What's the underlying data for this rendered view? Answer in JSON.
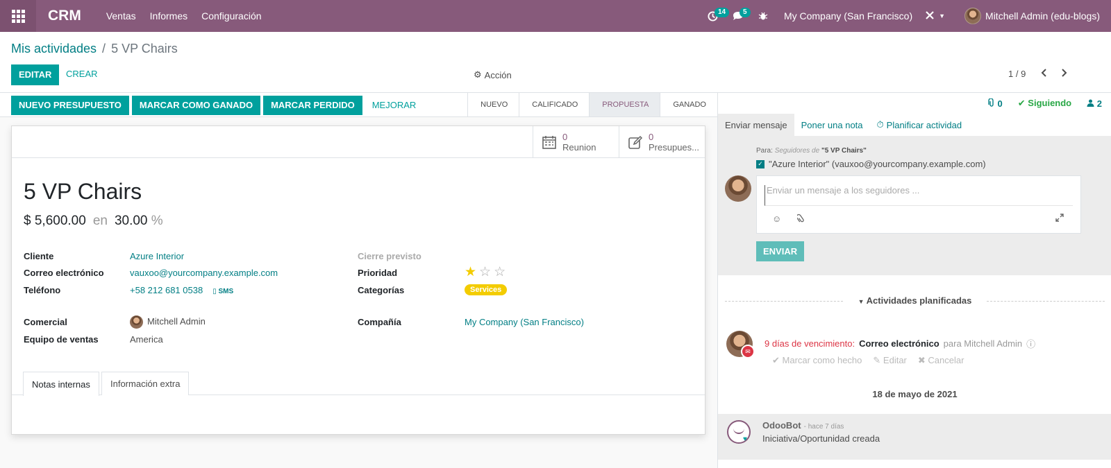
{
  "navbar": {
    "brand": "CRM",
    "menu": [
      "Ventas",
      "Informes",
      "Configuración"
    ],
    "activity_count": "14",
    "message_count": "5",
    "company": "My Company (San Francisco)",
    "user": "Mitchell Admin (edu-blogs)"
  },
  "breadcrumb": {
    "parent": "Mis actividades",
    "separator": "/",
    "current": "5 VP Chairs"
  },
  "toolbar": {
    "edit": "EDITAR",
    "create": "CREAR",
    "action": "Acción",
    "pager": "1 / 9"
  },
  "statusbar": {
    "buttons": [
      "NUEVO PRESUPUESTO",
      "MARCAR COMO GANADO",
      "MARCAR PERDIDO"
    ],
    "upgrade": "MEJORAR",
    "stages": [
      "NUEVO",
      "CALIFICADO",
      "PROPUESTA",
      "GANADO"
    ],
    "active_stage": "PROPUESTA"
  },
  "stats": {
    "meetings_count": "0",
    "meetings_label": "Reunion",
    "quotes_count": "0",
    "quotes_label": "Presupues..."
  },
  "record": {
    "title": "5 VP Chairs",
    "revenue": "$ 5,600.00",
    "at": "en",
    "probability": "30.00",
    "percent": "%"
  },
  "fields": {
    "customer_label": "Cliente",
    "customer": "Azure Interior",
    "email_label": "Correo electrónico",
    "email": "vauxoo@yourcompany.example.com",
    "phone_label": "Teléfono",
    "phone": "+58 212 681 0538",
    "sms": "SMS",
    "salesperson_label": "Comercial",
    "salesperson": "Mitchell Admin",
    "team_label": "Equipo de ventas",
    "team": "America",
    "deadline_label": "Cierre previsto",
    "priority_label": "Prioridad",
    "priority": 1,
    "priority_max": 3,
    "tags_label": "Categorías",
    "tag": "Services",
    "company_label": "Compañía",
    "company": "My Company (San Francisco)"
  },
  "tabs": [
    "Notas internas",
    "Información extra"
  ],
  "chatter": {
    "attachments": "0",
    "following": "Siguiendo",
    "followers": "2",
    "tabs": [
      "Enviar mensaje",
      "Poner una nota",
      "Planificar actividad"
    ],
    "to_label": "Para:",
    "to_followers": "Seguidores de",
    "to_record": "\"5 VP Chairs\"",
    "recipient": "\"Azure Interior\" (vauxoo@yourcompany.example.com)",
    "placeholder": "Enviar un mensaje a los seguidores ...",
    "send": "ENVIAR",
    "activities_header": "Actividades planificadas",
    "activity_due": "9 días de vencimiento:",
    "activity_type": "Correo electrónico",
    "activity_for": "para Mitchell Admin",
    "mark_done": "Marcar como hecho",
    "edit": "Editar",
    "cancel": "Cancelar",
    "date_separator": "18 de mayo de 2021",
    "message_author": "OdooBot",
    "message_date": "- hace 7 días",
    "message_body": "Iniciativa/Oportunidad creada"
  },
  "colors": {
    "navbar": "#875a7b",
    "primary": "#00a09d",
    "link": "#017e84",
    "star": "#f3cc00",
    "danger": "#dc3545"
  }
}
